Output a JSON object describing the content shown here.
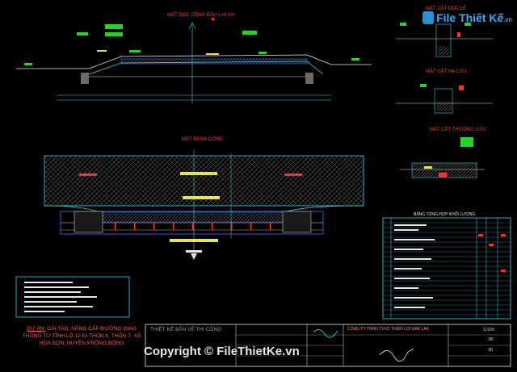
{
  "watermark": {
    "brand": "File Thiết Kế",
    "domain": ".vn"
  },
  "copyright": "Copyright © FileThietKe.vn",
  "project": {
    "prefix": "DỰ ÁN:",
    "text": "CẢI TẠO, NÂNG CẤP ĐƯỜNG GIAO THÔNG TỪ TỈNH LỘ 12 ĐI THÔN 6, THÔN 7, XÃ HÒA SƠN, HUYỆN KRÔNG BÔNG"
  },
  "title_block": {
    "stage": "THIẾT KẾ BẢN VẼ THI CÔNG",
    "company": "CÔNG TY TNHH TVXD THIÊN LỢI ĐAK LAK",
    "scale_value": "1/100",
    "sheet_value": "38",
    "total_value": "30"
  },
  "sections": {
    "longitudinal": "MẶT DỌC CỐNG ĐẦU L=8.0m",
    "plan": "MẶT BẰNG CỐNG",
    "side_a": "MẶT CẮT DỌC LẺ",
    "side_b": "MẶT CẮT HẠ LƯU",
    "side_c": "MẶT CẮT THƯỢNG LƯU",
    "table_title": "BẢNG TỔNG HỢP KHỐI LƯỢNG"
  },
  "colors": {
    "background": "#000000",
    "cyan": "#3fd0e6",
    "green": "#28d228",
    "yellow": "#e6e64a",
    "red": "#ff3030",
    "blue": "#4a6cff",
    "white": "#e8e8e8"
  }
}
